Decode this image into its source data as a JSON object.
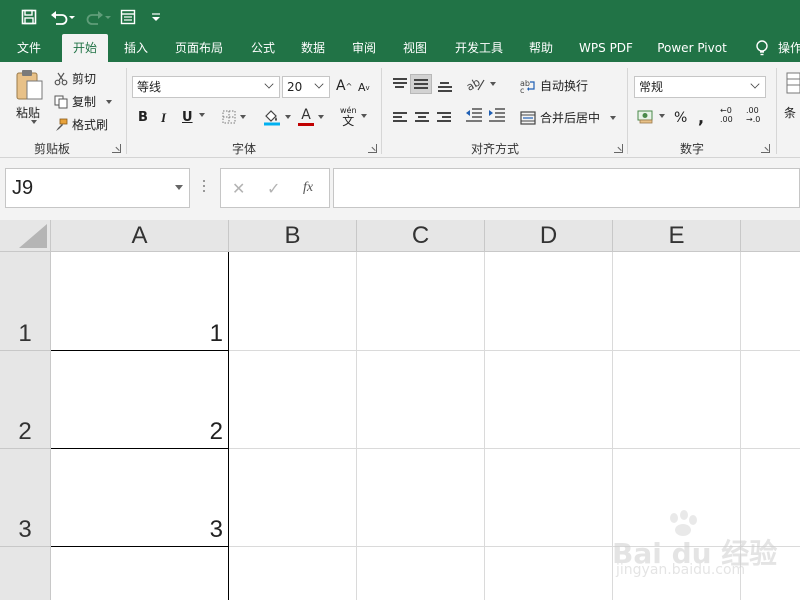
{
  "ribbon_tabs": [
    {
      "label": "文件"
    },
    {
      "label": "开始",
      "active": true
    },
    {
      "label": "插入"
    },
    {
      "label": "页面布局"
    },
    {
      "label": "公式"
    },
    {
      "label": "数据"
    },
    {
      "label": "审阅"
    },
    {
      "label": "视图"
    },
    {
      "label": "开发工具"
    },
    {
      "label": "帮助"
    },
    {
      "label": "WPS PDF"
    },
    {
      "label": "Power Pivot"
    },
    {
      "label": "操作"
    }
  ],
  "clipboard": {
    "paste": "粘贴",
    "cut": "剪切",
    "copy": "复制",
    "format_painter": "格式刷",
    "group": "剪贴板"
  },
  "font": {
    "name": "等线",
    "size": "20",
    "bold": "B",
    "italic": "I",
    "underline": "U",
    "phonetic_top": "wén",
    "phonetic_bottom": "文",
    "font_color_letter": "A",
    "grow_letter": "A",
    "shrink_letter": "A",
    "group": "字体",
    "fill_color": "#00b0f0",
    "text_color": "#c00000"
  },
  "alignment": {
    "wrap_text": "自动换行",
    "merge_center": "合并后居中",
    "group": "对齐方式"
  },
  "number": {
    "format": "常规",
    "percent": "%",
    "comma": ",",
    "increase_decimal_top": "←0",
    "increase_decimal_bottom": ".00",
    "decrease_decimal_top": ".00",
    "decrease_decimal_bottom": "→.0",
    "group": "数字"
  },
  "styles": {
    "conditional_partial": "条"
  },
  "formula_bar": {
    "name_box": "J9",
    "cancel": "✕",
    "enter": "✓",
    "fx": "fx",
    "formula": ""
  },
  "columns": [
    "A",
    "B",
    "C",
    "D",
    "E"
  ],
  "rows": [
    {
      "label": "1",
      "a": "1"
    },
    {
      "label": "2",
      "a": "2"
    },
    {
      "label": "3",
      "a": "3"
    },
    {
      "label": "",
      "a": ""
    }
  ],
  "watermark": {
    "logo": "Bai du 经验",
    "url": "jingyan.baidu.com"
  },
  "colors": {
    "excel_green": "#217346",
    "ribbon_bg": "#f3f3f3",
    "header_bg": "#e6e6e6"
  }
}
